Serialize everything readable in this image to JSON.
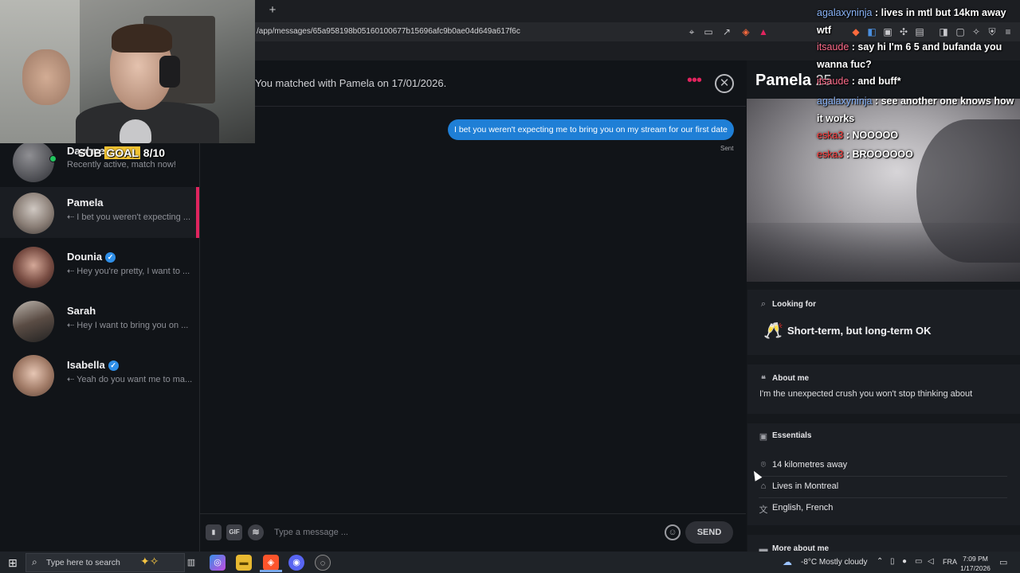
{
  "browser": {
    "new_tab": "+",
    "url": "/app/messages/65a958198b05160100677b15696afc9b0ae04d649a617f6c"
  },
  "stream_overlay": {
    "sub_goal_prefix": "SUB",
    "sub_goal_highlight": "GOAL",
    "sub_goal_value": "8/10",
    "chat": [
      {
        "user": "agalaxyninja",
        "user_color": "#8ab4f8",
        "message": "lives in mtl but 14km away wtf"
      },
      {
        "user": "itsaude",
        "user_color": "#ff6b8a",
        "message": "say hi I'm 6 5 and bufanda you wanna fuc?"
      },
      {
        "user": "itsaude",
        "user_color": "#ff6b8a",
        "message": "and buff*"
      },
      {
        "user": "agalaxyninja",
        "user_color": "#8ab4f8",
        "message": "see another one knows how it works"
      },
      {
        "user": "eska3",
        "user_color": "#ff3b3b",
        "message": "NOOOOO"
      },
      {
        "user": "eska3",
        "user_color": "#ff3b3b",
        "message": "BROOOOOO"
      }
    ]
  },
  "sidebar": {
    "matches": [
      {
        "name": "Daphne",
        "preview": "Recently active, match now!",
        "verified": false,
        "online": true
      },
      {
        "name": "Pamela",
        "preview": "I bet you weren't expecting ...",
        "verified": false,
        "active": true
      },
      {
        "name": "Dounia",
        "preview": "Hey you're pretty, I want to ...",
        "verified": true
      },
      {
        "name": "Sarah",
        "preview": "Hey I want to bring you on ...",
        "verified": false
      },
      {
        "name": "Isabella",
        "preview": "Yeah do you want me to ma...",
        "verified": true
      }
    ]
  },
  "chat": {
    "match_info": "You matched with Pamela on 17/01/2026.",
    "more_icon": "more-dots-icon",
    "close_icon": "close-icon",
    "messages": [
      {
        "text": "I bet you weren't expecting me to bring you on my stream for our first date",
        "status": "Sent"
      }
    ],
    "composer": {
      "placeholder": "Type a message ...",
      "gif_label": "GIF",
      "send_label": "SEND"
    }
  },
  "profile": {
    "name": "Pamela",
    "age": "25",
    "looking_for": {
      "title": "Looking for",
      "emoji": "🥂",
      "value": "Short-term, but long-term OK"
    },
    "about": {
      "title": "About me",
      "text": "I'm the unexpected crush you won't stop thinking about"
    },
    "essentials": {
      "title": "Essentials",
      "items": [
        {
          "icon": "location-pin-icon",
          "text": "14 kilometres away"
        },
        {
          "icon": "home-icon",
          "text": "Lives in Montreal"
        },
        {
          "icon": "language-icon",
          "text": "English, French"
        }
      ]
    },
    "more_about_me": "More about me"
  },
  "taskbar": {
    "search_placeholder": "Type here to search",
    "weather": "-8°C  Mostly cloudy",
    "language": "FRA",
    "time": "7:09 PM",
    "date": "1/17/2026"
  },
  "colors": {
    "accent": "#e0245e",
    "bubble": "#1f7fd6",
    "verified": "#2f8fe8",
    "online": "#22c55e"
  }
}
